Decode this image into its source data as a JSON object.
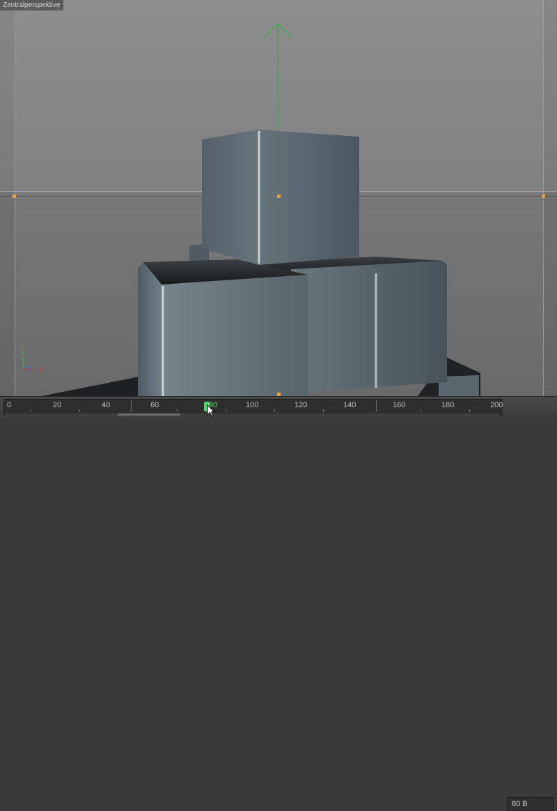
{
  "viewport": {
    "title": "Zentralperspektive",
    "background_top": "#8e8e8e",
    "background_bottom": "#6a6a6a"
  },
  "scene": {
    "object_color": "#5d6971",
    "handle_color": "#f0a03c",
    "move_arrow_color": "#3fa84a"
  },
  "axis_widget": {
    "x_label": "X",
    "y_label": "Y",
    "z_label": "Z",
    "x_color": "#d23a3a",
    "y_color": "#3fbf4f",
    "z_color": "#4a6ad8"
  },
  "timeline": {
    "ticks": [
      "0",
      "20",
      "40",
      "60",
      "80",
      "100",
      "120",
      "140",
      "160",
      "180",
      "200"
    ],
    "current_frame": "80",
    "current_frame_field": "80 B",
    "playhead_color": "#53d46a"
  }
}
